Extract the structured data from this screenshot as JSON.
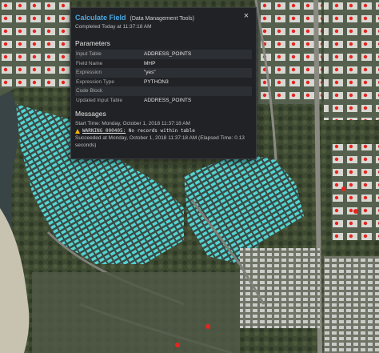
{
  "dialog": {
    "title": "Calculate Field",
    "subtitle": "(Data Management Tools)",
    "completed": "Completed Today at 11:37:18 AM",
    "close_glyph": "×"
  },
  "parameters": {
    "heading": "Parameters",
    "rows": [
      {
        "key": "Input Table",
        "value": "ADDRESS_POINTS"
      },
      {
        "key": "Field Name",
        "value": "MHP"
      },
      {
        "key": "Expression",
        "value": "\"yes\""
      },
      {
        "key": "Expression Type",
        "value": "PYTHON3"
      },
      {
        "key": "Code Block",
        "value": ""
      },
      {
        "key": "Updated Input Table",
        "value": "ADDRESS_POINTS"
      }
    ]
  },
  "messages": {
    "heading": "Messages",
    "start": "Start Time: Monday, October 1, 2018 11:37:18 AM",
    "warning_code": "WARNING 000405:",
    "warning_text": " No records within table",
    "success_line1": "Succeeded at Monday, October 1, 2018 11:37:18 AM (Elapsed Time: 0.13",
    "success_line2": "seconds)"
  },
  "colors": {
    "accent": "#4aa9e4",
    "panel": "#202225",
    "warning": "#f4b400",
    "selected_point": "#e8231f",
    "selected_parcel": "#4fd2d2"
  }
}
